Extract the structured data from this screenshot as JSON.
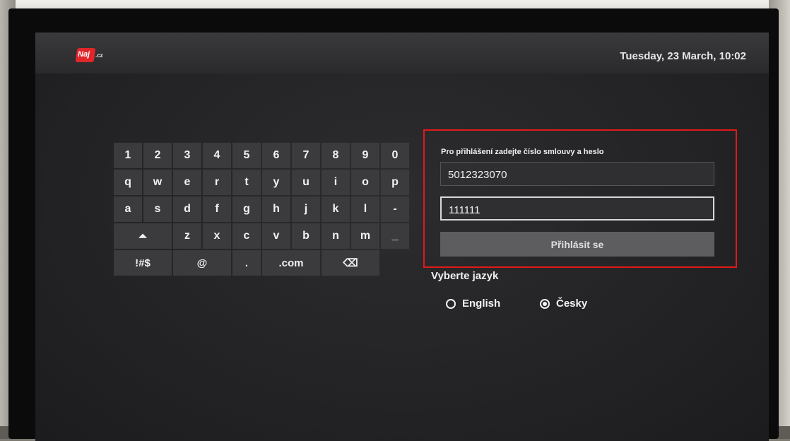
{
  "header": {
    "logo_text": "Naj",
    "logo_suffix": ".cz",
    "datetime": "Tuesday, 23 March, 10:02"
  },
  "keyboard": {
    "rows": [
      [
        "1",
        "2",
        "3",
        "4",
        "5",
        "6",
        "7",
        "8",
        "9",
        "0"
      ],
      [
        "q",
        "w",
        "e",
        "r",
        "t",
        "y",
        "u",
        "i",
        "o",
        "p"
      ],
      [
        "a",
        "s",
        "d",
        "f",
        "g",
        "h",
        "j",
        "k",
        "l",
        "-"
      ],
      [
        "⏶",
        "z",
        "x",
        "c",
        "v",
        "b",
        "n",
        "m",
        "_"
      ],
      [
        "!#$",
        "@",
        ".",
        ".com",
        "⌫"
      ]
    ]
  },
  "login": {
    "prompt": "Pro přihlášení zadejte číslo smlouvy a heslo",
    "contract_value": "5012323070",
    "password_value": "111111",
    "button_label": "Přihlásit se",
    "highlight_color": "#e01a1a"
  },
  "language": {
    "title": "Vyberte jazyk",
    "options": [
      {
        "label": "English",
        "selected": false
      },
      {
        "label": "Česky",
        "selected": true
      }
    ]
  },
  "colors": {
    "brand": "#e0262b",
    "screen_bg": "#232325"
  }
}
